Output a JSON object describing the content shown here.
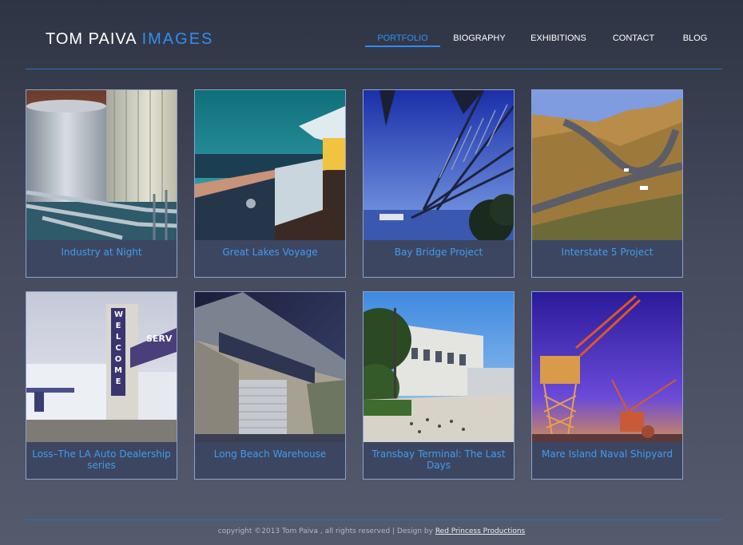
{
  "brand": {
    "name": "TOM PAIVA",
    "suffix": "IMAGES",
    "accent": "#2e8ff0"
  },
  "nav": {
    "items": [
      "PORTFOLIO",
      "BIOGRAPHY",
      "EXHIBITIONS",
      "CONTACT",
      "BLOG"
    ],
    "active": "PORTFOLIO"
  },
  "gallery": [
    {
      "title": "Industry at Night"
    },
    {
      "title": "Great Lakes Voyage"
    },
    {
      "title": "Bay Bridge Project"
    },
    {
      "title": "Interstate 5 Project"
    },
    {
      "title": "Loss–The LA Auto Dealership series"
    },
    {
      "title": "Long Beach Warehouse"
    },
    {
      "title": "Transbay Terminal: The Last Days"
    },
    {
      "title": "Mare Island Naval Shipyard"
    }
  ],
  "photo_words": {
    "sign_vertical": "WELCOME",
    "sign_horizontal": "SERV"
  },
  "footer": {
    "text": "copyright ©2013 Tom Paiva , all rights reserved | Design by",
    "link": "Red Princess Productions"
  }
}
